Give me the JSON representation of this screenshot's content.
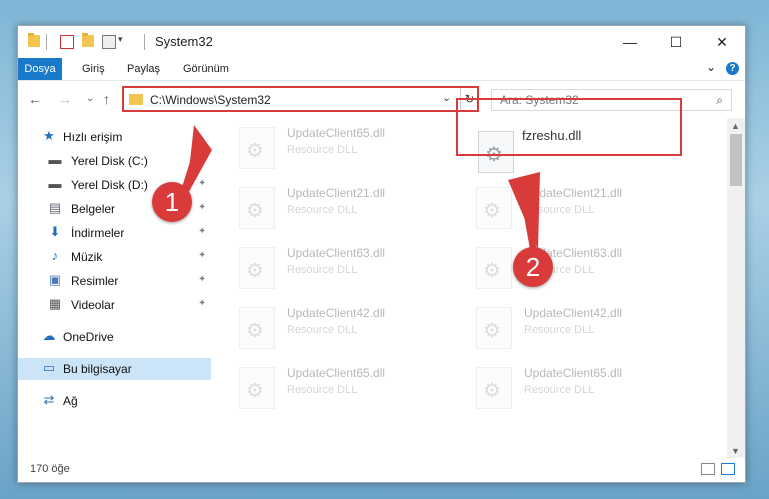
{
  "window": {
    "title": "System32",
    "minimize": "—",
    "maximize": "☐",
    "close": "✕"
  },
  "ribbon": {
    "tabs": [
      "Dosya",
      "Giriş",
      "Paylaş",
      "Görünüm"
    ],
    "expand": "⌄"
  },
  "nav": {
    "back": "←",
    "forward": "→",
    "recent": "⌄",
    "up": "↑",
    "address": "C:\\Windows\\System32",
    "refresh": "↻",
    "search_placeholder": "Ara: System32"
  },
  "sidebar": {
    "items": [
      {
        "label": "Hızlı erişim",
        "icon": "star-icon",
        "glyph": "★"
      },
      {
        "label": "Yerel Disk (C:)",
        "icon": "drive-icon",
        "glyph": "▬"
      },
      {
        "label": "Yerel Disk (D:)",
        "icon": "drive-icon",
        "glyph": "▬"
      },
      {
        "label": "Belgeler",
        "icon": "document-icon",
        "glyph": "▤"
      },
      {
        "label": "İndirmeler",
        "icon": "download-icon",
        "glyph": "⬇"
      },
      {
        "label": "Müzik",
        "icon": "music-icon",
        "glyph": "♪"
      },
      {
        "label": "Resimler",
        "icon": "pictures-icon",
        "glyph": "▣"
      },
      {
        "label": "Videolar",
        "icon": "video-icon",
        "glyph": "▦"
      },
      {
        "label": "OneDrive",
        "icon": "cloud-icon",
        "glyph": "☁"
      },
      {
        "label": "Bu bilgisayar",
        "icon": "computer-icon",
        "glyph": "▭"
      },
      {
        "label": "Ağ",
        "icon": "network-icon",
        "glyph": "⇄"
      }
    ],
    "pin": "📌"
  },
  "files": {
    "left": [
      {
        "name": "UpdateClient65.dll",
        "type": "Resource DLL"
      },
      {
        "name": "UpdateClient21.dll",
        "type": "Resource DLL"
      },
      {
        "name": "UpdateClient63.dll",
        "type": "Resource DLL"
      },
      {
        "name": "UpdateClient42.dll",
        "type": "Resource DLL"
      },
      {
        "name": "UpdateClient65.dll",
        "type": "Resource DLL"
      }
    ],
    "right": [
      {
        "name": "fzreshu.dll",
        "type": ""
      },
      {
        "name": "UpdateClient21.dll",
        "type": "Resource DLL"
      },
      {
        "name": "UpdateClient63.dll",
        "type": "Resource DLL"
      },
      {
        "name": "UpdateClient42.dll",
        "type": "Resource DLL"
      },
      {
        "name": "UpdateClient65.dll",
        "type": "Resource DLL"
      }
    ]
  },
  "status": {
    "count": "170 öğe"
  },
  "annotations": {
    "step1": "1",
    "step2": "2",
    "color": "#d93b3b"
  }
}
